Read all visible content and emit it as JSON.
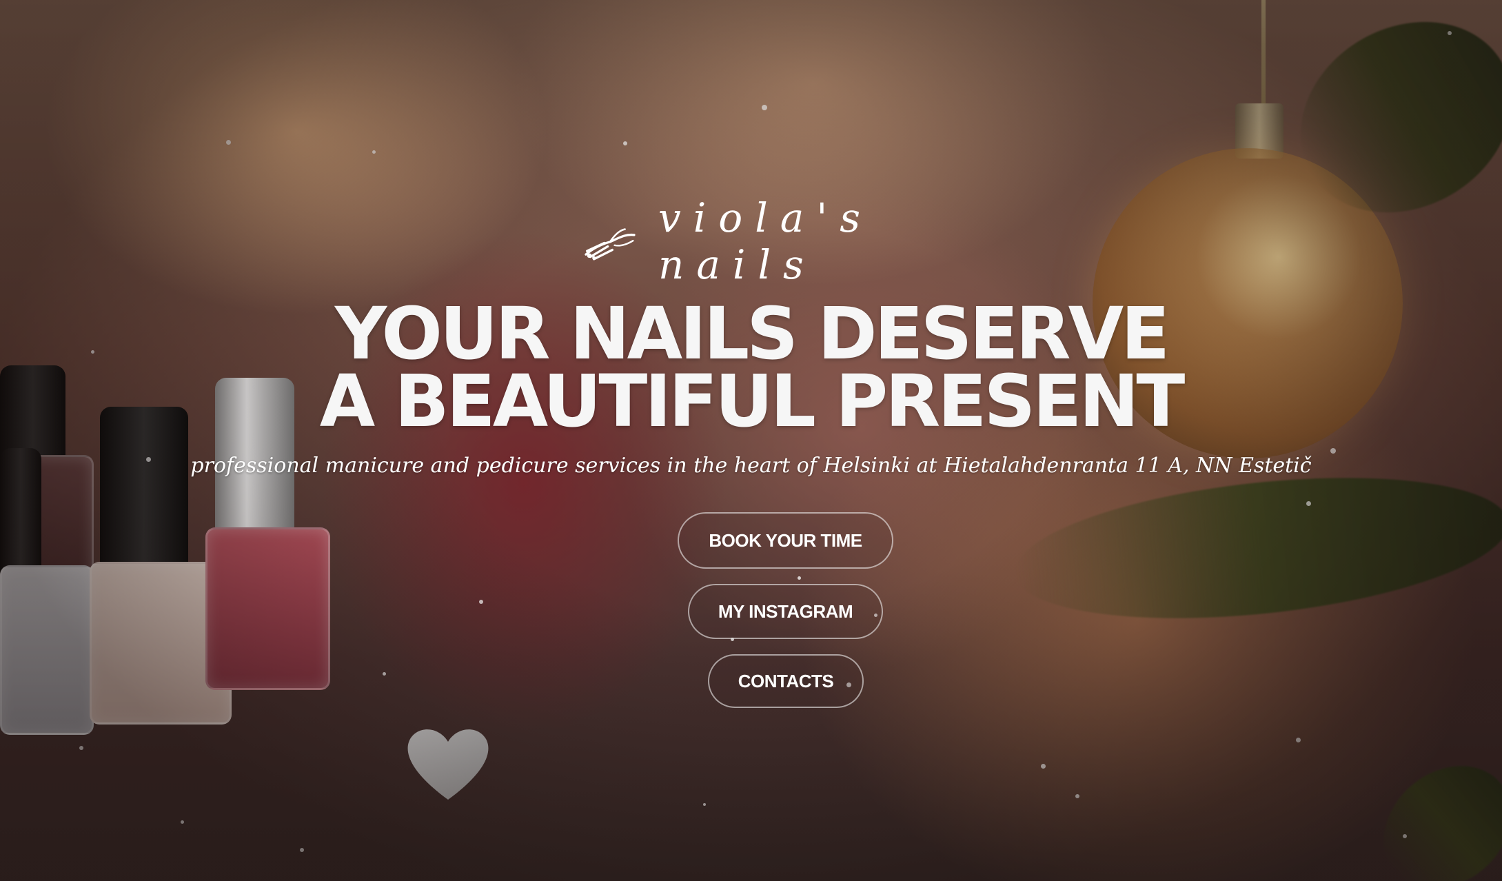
{
  "logo": {
    "text": "viola's nails",
    "icon": "hand-nails-icon"
  },
  "hero": {
    "headline_line1": "YOUR NAILS DESERVE",
    "headline_line2": "A BEAUTIFUL PRESENT",
    "subtitle": "professional manicure and pedicure services in the heart of Helsinki at Hietalahdenranta 11 A, NN Estetič"
  },
  "buttons": {
    "book": "BOOK YOUR TIME",
    "instagram": "MY INSTAGRAM",
    "contacts": "CONTACTS"
  },
  "colors": {
    "text": "#ffffff",
    "button_border": "#ffffff"
  }
}
